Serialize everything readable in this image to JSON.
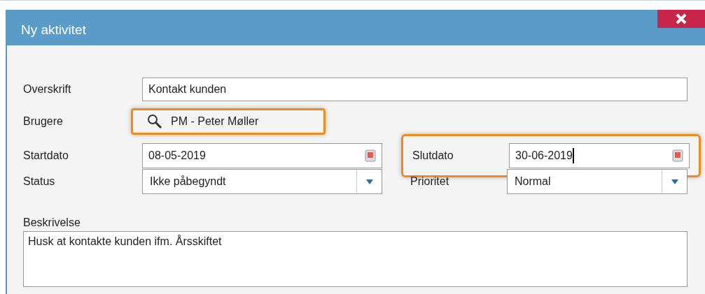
{
  "window": {
    "title": "Ny aktivitet"
  },
  "fields": {
    "overskrift": {
      "label": "Overskrift",
      "value": "Kontakt kunden"
    },
    "brugere": {
      "label": "Brugere",
      "value": "PM - Peter Møller",
      "highlighted": true
    },
    "startdato": {
      "label": "Startdato",
      "value": "08-05-2019",
      "highlighted": false
    },
    "slutdato": {
      "label": "Slutdato",
      "value": "30-06-2019",
      "highlighted": true,
      "focused": true
    },
    "status": {
      "label": "Status",
      "value": "Ikke påbegyndt"
    },
    "prioritet": {
      "label": "Prioritet",
      "value": "Normal"
    },
    "beskrivelse": {
      "label": "Beskrivelse",
      "value": "Husk at kontakte kunden ifm. Årsskiftet"
    }
  }
}
